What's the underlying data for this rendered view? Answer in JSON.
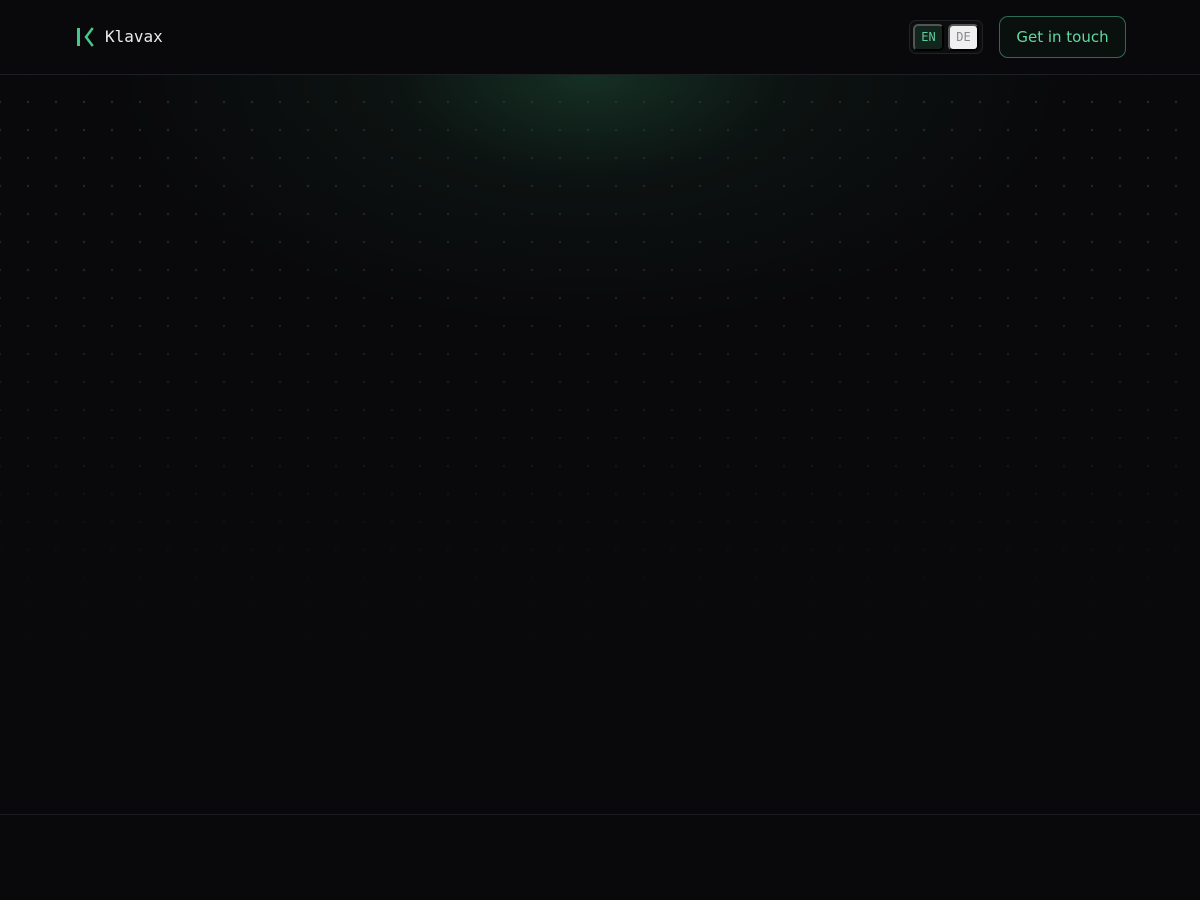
{
  "header": {
    "brand": {
      "name": "Klavax",
      "logo_icon": "k-bracket-logo",
      "accent_color": "#45c98b"
    },
    "language_switch": {
      "options": [
        "EN",
        "DE"
      ],
      "selected": "EN"
    },
    "cta": {
      "label": "Get in touch"
    }
  },
  "theme": {
    "background": "#09090b",
    "accent": "#5fc89a"
  }
}
